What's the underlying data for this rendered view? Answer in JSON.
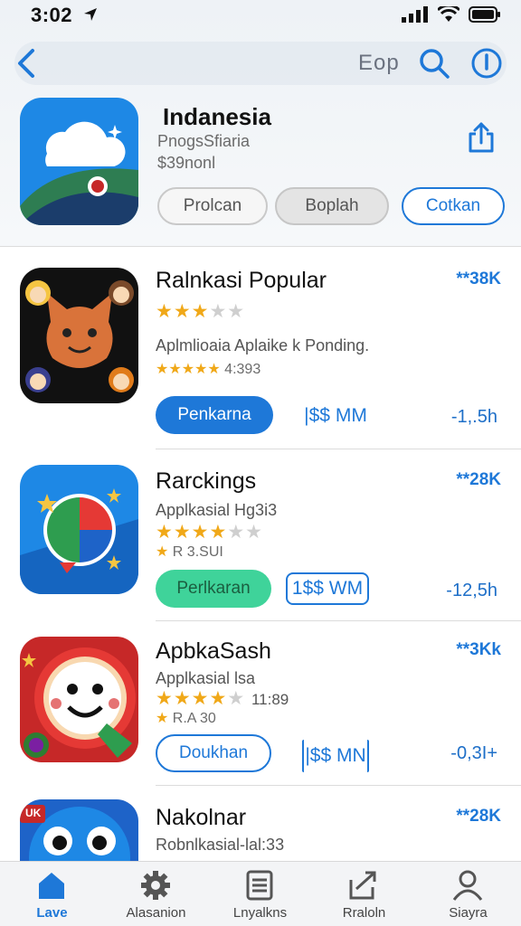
{
  "status": {
    "time": "3:02"
  },
  "nav": {
    "label": "Eop"
  },
  "featured": {
    "title": "Indanesia",
    "subtitle": "PnogsSfiaria",
    "price_line": "$39nonl",
    "buttons": [
      "Prolcan",
      "Boplah",
      "Cotkan"
    ]
  },
  "apps": [
    {
      "name": "Ralnkasi Popular",
      "rank": "**38K",
      "rating": 3,
      "subtitle": "Aplmlioaia Aplaike k Ponding.",
      "subtitle2": "4:393",
      "action": "Penkarna",
      "price": "|$$ MM",
      "size": "-1,.5h"
    },
    {
      "name": "Rarckings",
      "rank": "**28K",
      "rating": 4,
      "subtitle": "Applkasial Hg3i3",
      "subtitle2": "R 3.SUI",
      "action": "Perlkaran",
      "price": "1$$ WM",
      "size": "-12,5h"
    },
    {
      "name": "ApbkaSash",
      "rank": "**3Kk",
      "rating": 4,
      "subtitle": "Applkasial lsa",
      "subtitle2": "11:89",
      "subtitle3": "R.A 30",
      "action": "Doukhan",
      "price": "|$$ MN",
      "size": "-0,3I+"
    },
    {
      "name": "Nakolnar",
      "rank": "**28K",
      "subtitle": "Robnlkasial-lal:33"
    }
  ],
  "tabs": [
    "Lave",
    "Alasanion",
    "Lnyalkns",
    "Rraloln",
    "Siayra"
  ],
  "colors": {
    "accent": "#1e78d8",
    "action_blue": "#1e78d8",
    "action_green": "#3fd39a",
    "star": "#f0a818"
  }
}
